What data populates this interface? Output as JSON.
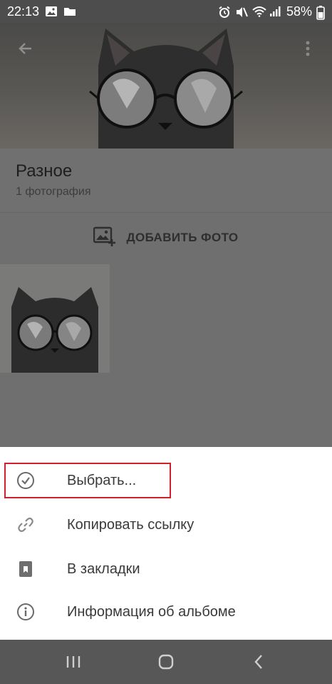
{
  "status_bar": {
    "time": "22:13",
    "battery": "58%",
    "icons": [
      "image-icon",
      "folder-icon",
      "alarm-icon",
      "mute-icon",
      "wifi-icon",
      "signal-icon",
      "battery-icon"
    ]
  },
  "header": {
    "back_icon": "arrow-left-icon",
    "more_icon": "more-vertical-icon"
  },
  "album": {
    "title": "Разное",
    "count": "1 фотография"
  },
  "add_photo": {
    "label": "ДОБАВИТЬ ФОТО",
    "icon": "add-photo-icon"
  },
  "menu": {
    "items": [
      {
        "label": "Выбрать...",
        "icon": "check-circle-icon"
      },
      {
        "label": "Копировать ссылку",
        "icon": "link-icon"
      },
      {
        "label": "В закладки",
        "icon": "bookmark-icon"
      },
      {
        "label": "Информация об альбоме",
        "icon": "info-icon"
      }
    ],
    "highlight_color": "#d0202e"
  },
  "nav_bar": {
    "buttons": [
      "recent-apps-icon",
      "home-icon",
      "back-icon"
    ]
  }
}
